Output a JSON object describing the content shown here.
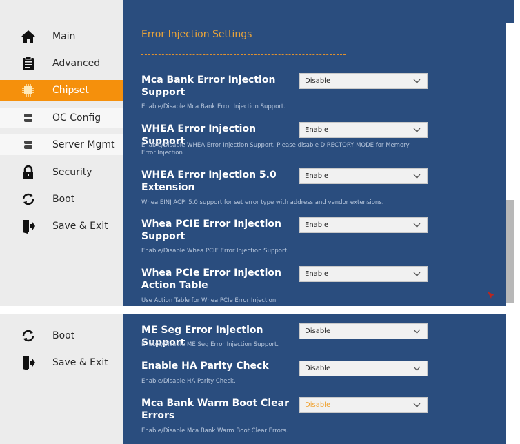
{
  "sidebar": {
    "items": [
      {
        "label": "Main",
        "icon": "home-icon"
      },
      {
        "label": "Advanced",
        "icon": "clipboard-icon"
      },
      {
        "label": "Chipset",
        "icon": "chip-icon",
        "active": true
      },
      {
        "label": "OC Config",
        "icon": "server-icon"
      },
      {
        "label": "Server Mgmt",
        "icon": "server-icon"
      },
      {
        "label": "Security",
        "icon": "lock-icon"
      },
      {
        "label": "Boot",
        "icon": "refresh-icon"
      },
      {
        "label": "Save & Exit",
        "icon": "exit-door-icon"
      }
    ]
  },
  "main": {
    "section_title": "Error Injection Settings",
    "settings": [
      {
        "label": "Mca Bank Error Injection Support",
        "help": "Enable/Disable Mca Bank Error Injection Support.",
        "value": "Disable"
      },
      {
        "label": "WHEA Error Injection Support",
        "help": "Enable/Disable WHEA Error Injection Support. Please disable DIRECTORY MODE for Memory Error Injection",
        "value": "Enable"
      },
      {
        "label": "WHEA Error Injection 5.0 Extension",
        "help": "Whea EINJ ACPI 5.0 support for set error type with address and vendor extensions.",
        "value": "Enable"
      },
      {
        "label": "Whea PCIE Error Injection Support",
        "help": "Enable/Disable Whea PCIE Error Injection Support.",
        "value": "Enable"
      },
      {
        "label": "Whea PCIe Error Injection Action Table",
        "help": "Use Action Table for Whea PCIe Error Injection",
        "value": "Enable"
      }
    ]
  },
  "bottom_sidebar": {
    "items": [
      {
        "label": "Boot",
        "icon": "refresh-icon"
      },
      {
        "label": "Save & Exit",
        "icon": "exit-door-icon"
      }
    ]
  },
  "bottom_settings": [
    {
      "label": "ME Seg Error Injection Support",
      "help": "Enable/Disable ME Seg Error Injection Support.",
      "value": "Disable"
    },
    {
      "label": "Enable HA Parity Check",
      "help": "Enable/Disable HA Parity Check.",
      "value": "Disable"
    },
    {
      "label": "Mca Bank Warm Boot Clear Errors",
      "help": "Enable/Disable Mca Bank Warm Boot Clear Errors.",
      "value": "Disable",
      "value_color": "#f0a02c"
    }
  ],
  "colors": {
    "content_bg": "#2a4d7e",
    "sidebar_bg": "#ececec",
    "accent": "#f5900c",
    "title": "#e8a33a"
  }
}
